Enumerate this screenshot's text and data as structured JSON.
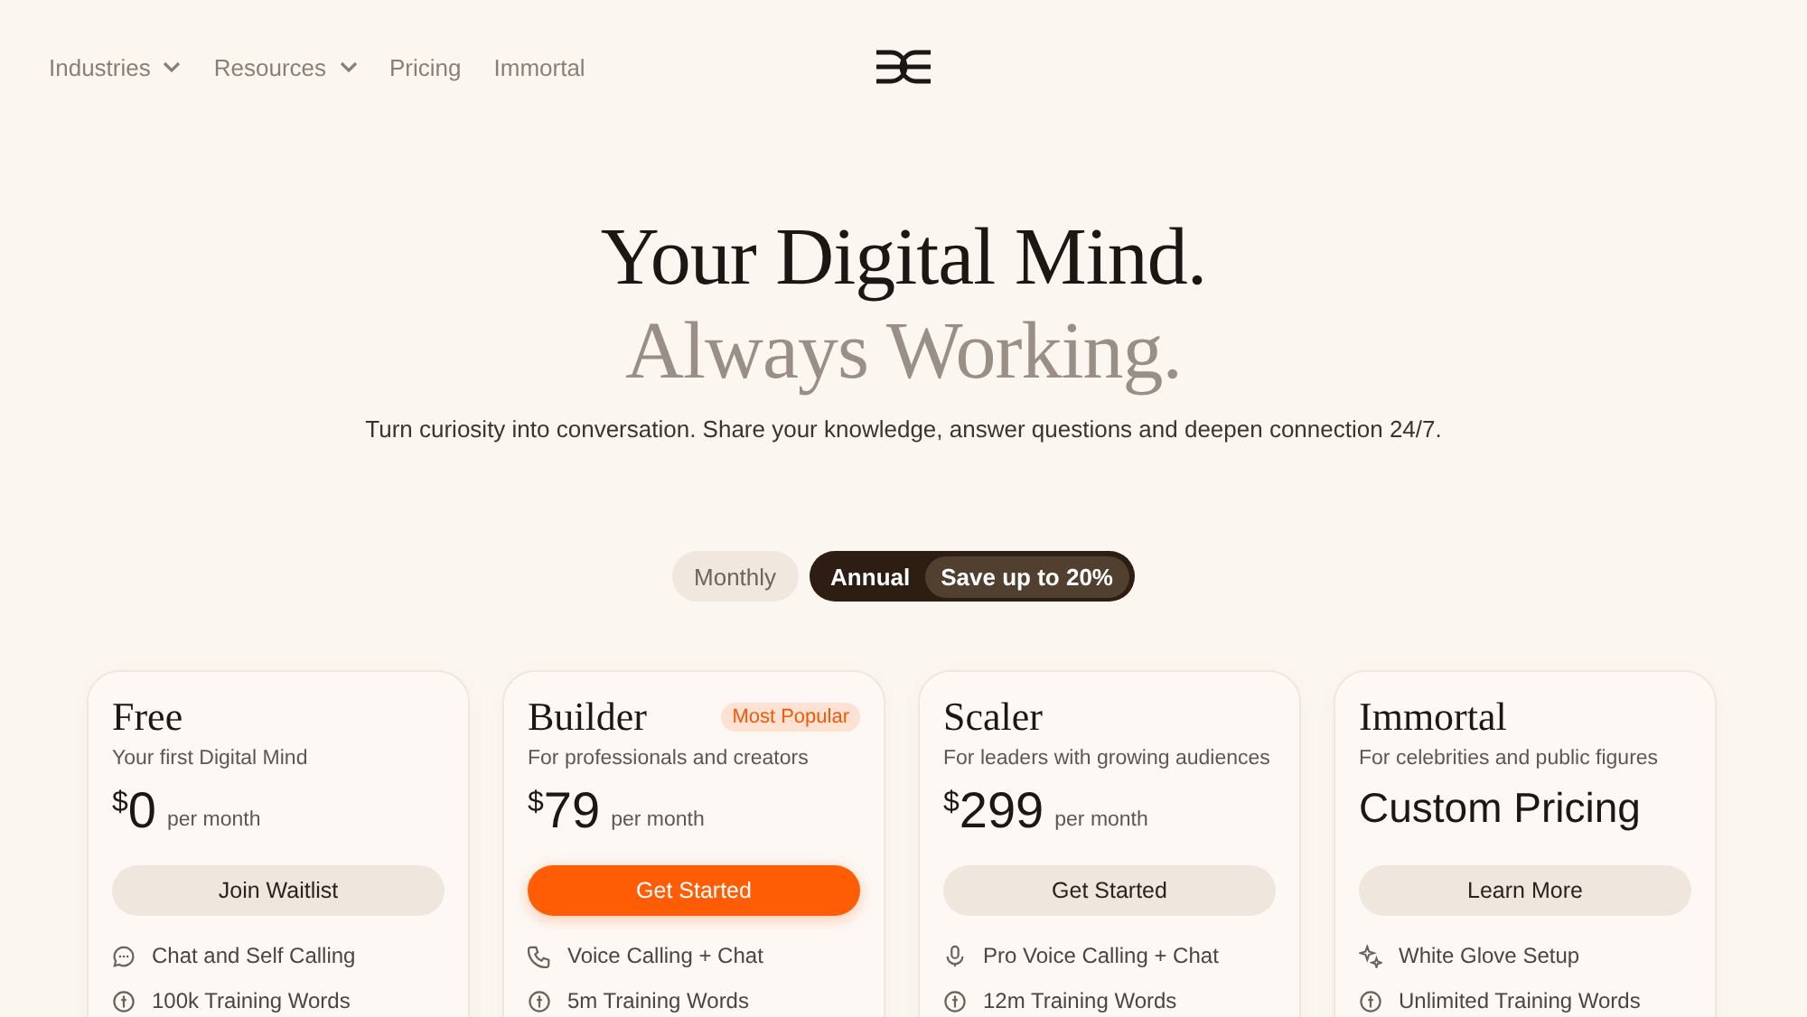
{
  "nav": [
    {
      "label": "Industries",
      "has_menu": true
    },
    {
      "label": "Resources",
      "has_menu": true
    },
    {
      "label": "Pricing",
      "has_menu": false
    },
    {
      "label": "Immortal",
      "has_menu": false
    }
  ],
  "hero": {
    "title": "Your Digital Mind.",
    "title_secondary": "Always Working.",
    "subtitle": "Turn curiosity into conversation. Share your knowledge, answer questions and deepen connection 24/7."
  },
  "billing_toggle": [
    {
      "label": "Monthly",
      "selected": false
    },
    {
      "label": "Annual",
      "selected": true,
      "badge": "Save up to 20%"
    }
  ],
  "plans": [
    {
      "name": "Free",
      "description": "Your first Digital Mind",
      "currency": "$",
      "price": "0",
      "period": "per month",
      "button": {
        "label": "Join Waitlist",
        "kind": "secondary"
      },
      "features": [
        {
          "kind": "chat",
          "label": "Chat and Self Calling"
        },
        {
          "kind": "words",
          "label": "100k Training Words"
        }
      ]
    },
    {
      "name": "Builder",
      "badge": "Most Popular",
      "description": "For professionals and creators",
      "currency": "$",
      "price": "79",
      "period": "per month",
      "button": {
        "label": "Get Started",
        "kind": "primary"
      },
      "features": [
        {
          "kind": "phone",
          "label": "Voice Calling + Chat"
        },
        {
          "kind": "words",
          "label": "5m Training Words"
        }
      ]
    },
    {
      "name": "Scaler",
      "description": "For leaders with growing audiences",
      "currency": "$",
      "price": "299",
      "period": "per month",
      "button": {
        "label": "Get Started",
        "kind": "secondary"
      },
      "features": [
        {
          "kind": "mic",
          "label": "Pro Voice Calling + Chat"
        },
        {
          "kind": "words",
          "label": "12m Training Words"
        }
      ]
    },
    {
      "name": "Immortal",
      "description": "For celebrities and public figures",
      "custom_price": "Custom Pricing",
      "button": {
        "label": "Learn More",
        "kind": "secondary"
      },
      "features": [
        {
          "kind": "sparkle",
          "label": "White Glove Setup"
        },
        {
          "kind": "words",
          "label": "Unlimited Training Words"
        }
      ]
    }
  ]
}
